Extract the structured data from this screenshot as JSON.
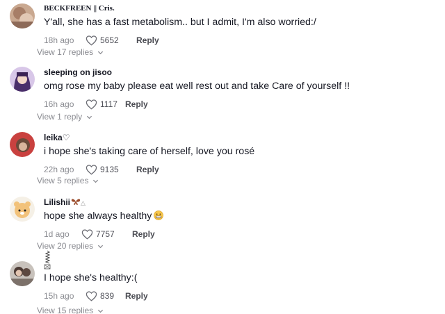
{
  "comments": [
    {
      "username": "BECKFREEN || Cris.",
      "text": "Y'all, she has a fast metabolism.. but I admit, I'm also worried:/",
      "time": "18h ago",
      "likes": "5652",
      "reply_label": "Reply",
      "view_replies": "View 17 replies"
    },
    {
      "username": "sleeping on jisoo",
      "text": "omg rose my baby please eat well rest out and take Care of yourself !!",
      "time": "16h ago",
      "likes": "1117",
      "reply_label": "Reply",
      "view_replies": "View 1 reply"
    },
    {
      "username": "leika♡",
      "text": "i hope she's taking care of herself, love you rosé",
      "time": "22h ago",
      "likes": "9135",
      "reply_label": "Reply",
      "view_replies": "View 5 replies"
    },
    {
      "username": "Lilishii",
      "text": "hope she always healthy",
      "time": "1d ago",
      "likes": "7757",
      "reply_label": "Reply",
      "view_replies": "View 20 replies"
    },
    {
      "username": "",
      "text": "I hope she's healthy:(",
      "time": "15h ago",
      "likes": "839",
      "reply_label": "Reply",
      "view_replies": "View 15 replies"
    }
  ],
  "icons": {
    "like": "heart-outline-icon",
    "chevron": "chevron-down-icon"
  },
  "colors": {
    "text": "#161823",
    "muted": "#8a8b91",
    "background": "#ffffff"
  }
}
